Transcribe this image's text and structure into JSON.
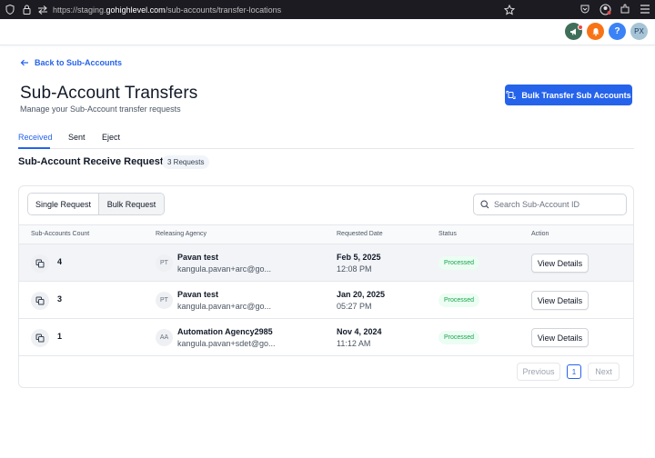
{
  "browser": {
    "url_prefix": "https://staging.",
    "url_domain": "gohighlevel.com",
    "url_path": "/sub-accounts/transfer-locations"
  },
  "header": {
    "avatar_initials": "PX",
    "help_glyph": "?"
  },
  "page": {
    "back_label": "Back to Sub-Accounts",
    "title": "Sub-Account Transfers",
    "subtitle": "Manage your Sub-Account transfer requests",
    "bulk_button": "Bulk Transfer Sub Accounts"
  },
  "tabs": [
    {
      "label": "Received",
      "active": true
    },
    {
      "label": "Sent",
      "active": false
    },
    {
      "label": "Eject",
      "active": false
    }
  ],
  "section": {
    "title": "Sub-Account Receive Requests",
    "badge": "3 Requests"
  },
  "toggle": {
    "single": "Single Request",
    "bulk": "Bulk Request"
  },
  "search": {
    "placeholder": "Search Sub-Account ID"
  },
  "table": {
    "columns": [
      "Sub-Accounts Count",
      "Releasing Agency",
      "Requested Date",
      "Status",
      "Action"
    ],
    "rows": [
      {
        "count": "4",
        "initials": "PT",
        "agency": "Pavan test",
        "email": "kangula.pavan+arc@go...",
        "date": "Feb 5, 2025",
        "time": "12:08 PM",
        "status": "Processed",
        "action": "View Details"
      },
      {
        "count": "3",
        "initials": "PT",
        "agency": "Pavan test",
        "email": "kangula.pavan+arc@go...",
        "date": "Jan 20, 2025",
        "time": "05:27 PM",
        "status": "Processed",
        "action": "View Details"
      },
      {
        "count": "1",
        "initials": "AA",
        "agency": "Automation Agency2985",
        "email": "kangula.pavan+sdet@go...",
        "date": "Nov 4, 2024",
        "time": "11:12 AM",
        "status": "Processed",
        "action": "View Details"
      }
    ]
  },
  "pagination": {
    "previous": "Previous",
    "page": "1",
    "next": "Next"
  },
  "colors": {
    "primary": "#2563eb",
    "success": "#16a34a",
    "header_green": "#3f6f5a",
    "header_orange": "#f97316",
    "header_blue": "#3b82f6",
    "avatar_bg": "#a7c4d6"
  }
}
